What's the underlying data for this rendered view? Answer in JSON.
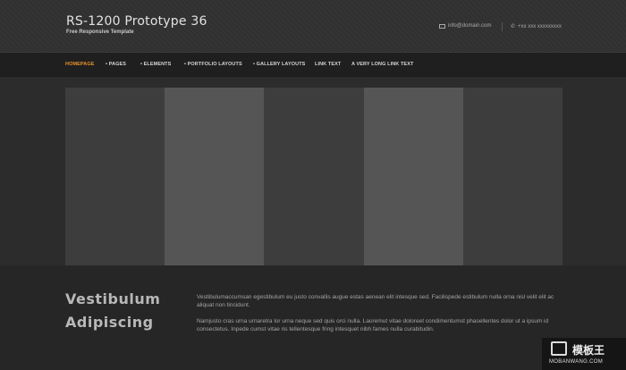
{
  "header": {
    "title": "RS-1200 Prototype 36",
    "tagline": "Free Responsive Template",
    "email": "info@domain.com",
    "phone": "+xx xxx xxxxxxxxx",
    "email_icon": "mail-icon",
    "phone_icon": "phone-icon"
  },
  "nav": {
    "items": [
      {
        "label": "HOMEPAGE",
        "active": true
      },
      {
        "label": "• PAGES"
      },
      {
        "label": "• ELEMENTS"
      },
      {
        "label": "• PORTFOLIO LAYOUTS"
      },
      {
        "label": "• GALLERY LAYOUTS"
      },
      {
        "label": "LINK TEXT"
      },
      {
        "label": "A VERY LONG LINK TEXT"
      }
    ]
  },
  "intro": {
    "heading": "Vestibulum Adipiscing",
    "paragraph_1": "Vestibulumaccumsan egestibulum eu justo convallis augue estas aenean elit intesque sed. Facilispede estibulum nulla orna nisl velit elit ac aliquat non tincidunt.",
    "paragraph_2": "Namjusto cras urna urnaretra lor urna neque sed quis orci nulla. Laoremut vitae doloreet condimentumst phasellentes dolor ut a ipsum id consectetus. Inpede cumst vitae ris tellentesque fring intesquet nibh fames nulla curabitudin."
  },
  "watermark": {
    "title": "模板王",
    "url": "MOBANWANG.COM"
  },
  "colors": {
    "accent": "#e8922b",
    "background": "#2c2c2c",
    "nav_background": "#1f1f1f"
  }
}
